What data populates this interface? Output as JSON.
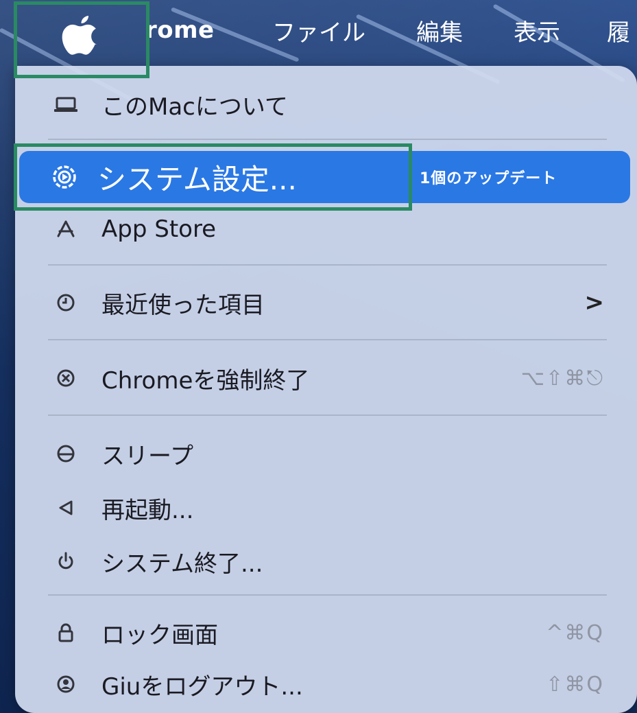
{
  "menubar": {
    "app_name_visible": "rome",
    "items": [
      "ファイル",
      "編集",
      "表示",
      "履"
    ]
  },
  "apple_menu": {
    "items": [
      {
        "id": "about",
        "icon": "laptop-icon",
        "label": "このMacについて"
      },
      {
        "id": "system_settings",
        "icon": "settings-icon",
        "label": "システム設定...",
        "badge": "1個のアップデート",
        "selected": true
      },
      {
        "id": "app_store",
        "icon": "app-store-icon",
        "label": "App Store"
      },
      {
        "id": "recent",
        "icon": "clock-icon",
        "label": "最近使った項目",
        "submenu": ">"
      },
      {
        "id": "force_quit",
        "icon": "force-quit-icon",
        "label": "Chromeを強制終了",
        "shortcut": "⌥⇧⌘⎋"
      },
      {
        "id": "sleep",
        "icon": "sleep-icon",
        "label": "スリープ"
      },
      {
        "id": "restart",
        "icon": "restart-icon",
        "label": "再起動..."
      },
      {
        "id": "shutdown",
        "icon": "power-icon",
        "label": "システム終了..."
      },
      {
        "id": "lock",
        "icon": "lock-icon",
        "label": "ロック画面",
        "shortcut": "^⌘Q"
      },
      {
        "id": "logout",
        "icon": "user-icon",
        "label": "Giuをログアウト...",
        "shortcut": "⇧⌘Q"
      }
    ]
  },
  "colors": {
    "selection": "#2a78e4",
    "highlight_box": "#2a8a63",
    "menu_bg": "#d2dcf0"
  }
}
